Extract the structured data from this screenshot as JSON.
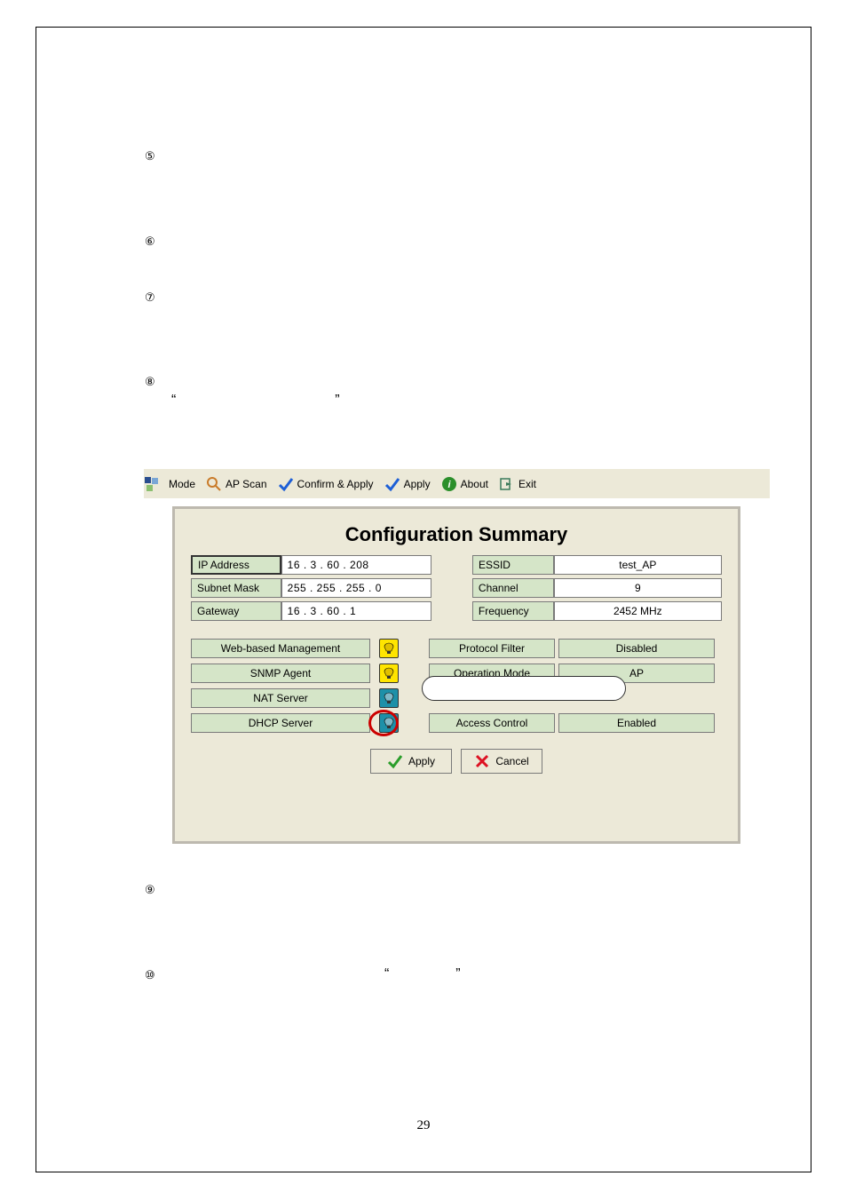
{
  "document": {
    "steps": [
      "⑤",
      "⑥",
      "⑦",
      "⑧",
      "⑨",
      "⑩"
    ],
    "quote_open": "“",
    "quote_close": "”",
    "page_number": "29"
  },
  "toolbar": {
    "mode": "Mode",
    "ap_scan": "AP Scan",
    "confirm_apply": "Confirm & Apply",
    "apply": "Apply",
    "about": "About",
    "exit": "Exit"
  },
  "panel": {
    "title": "Configuration Summary",
    "net": [
      {
        "label": "IP Address",
        "value": " 16  .  3   . 60  . 208",
        "label2": "ESSID",
        "value2": "test_AP"
      },
      {
        "label": "Subnet Mask",
        "value": "255 . 255 . 255 .   0",
        "label2": "Channel",
        "value2": "9"
      },
      {
        "label": "Gateway",
        "value": " 16  .  3   . 60  .   1",
        "label2": "Frequency",
        "value2": "2452 MHz"
      }
    ],
    "services": [
      {
        "label": "Web-based Management",
        "state": "on",
        "rlabel": "Protocol Filter",
        "rvalue": "Disabled"
      },
      {
        "label": "SNMP Agent",
        "state": "on",
        "rlabel": "Operation Mode",
        "rvalue": "AP"
      },
      {
        "label": "NAT Server",
        "state": "off"
      },
      {
        "label": "DHCP Server",
        "state": "off",
        "rlabel": "Access Control",
        "rvalue": "Enabled",
        "highlighted": true
      }
    ],
    "buttons": {
      "apply": "Apply",
      "cancel": "Cancel"
    }
  }
}
